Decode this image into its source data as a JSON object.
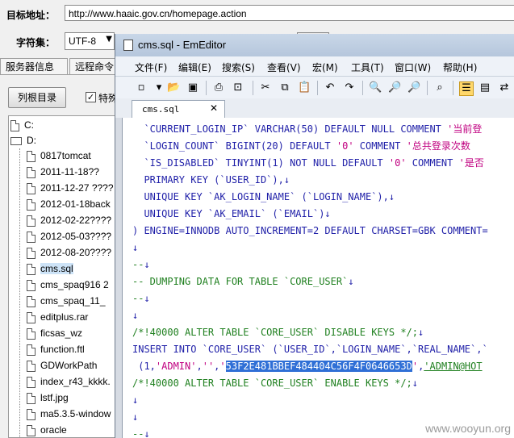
{
  "address": {
    "label": "目标地址：",
    "url": "http://www.haaic.gov.cn/homepage.action"
  },
  "charset": {
    "label": "字符集：",
    "value": "UTF-8"
  },
  "tabs": [
    {
      "label": "服务器信息"
    },
    {
      "label": "远程命令"
    }
  ],
  "root_button": "列根目录",
  "checkbox_label": "特殊",
  "tree": {
    "drives": [
      "C:",
      "D:"
    ],
    "items": [
      "0817tomcat",
      "2011-11-18??",
      "2011-12-27 ????",
      "2012-01-18back",
      "2012-02-22????",
      "2012-05-03????",
      "2012-08-20????",
      "cms.sql",
      "cms_spaq916 2",
      "cms_spaq_11_",
      "editplus.rar",
      "ficsas_wz",
      "function.ftl",
      "GDWorkPath",
      "index_r43_kkkk.",
      "lstf.jpg",
      "ma5.3.5-window",
      "oracle"
    ],
    "selected": "cms.sql"
  },
  "editor": {
    "title": "cms.sql - EmEditor",
    "menu": [
      "文件(F)",
      "编辑(E)",
      "搜索(S)",
      "查看(V)",
      "宏(M)",
      "工具(T)",
      "窗口(W)",
      "帮助(H)"
    ],
    "doc_tab": "cms.sql",
    "lines": [
      {
        "segs": [
          [
            "kw",
            "  `CURRENT_LOGIN_IP` VARCHAR(50) DEFAULT NULL COMMENT "
          ],
          [
            "str",
            "'当前登"
          ]
        ]
      },
      {
        "segs": [
          [
            "kw",
            "  `LOGIN_COUNT` BIGINT(20) DEFAULT "
          ],
          [
            "str",
            "'0'"
          ],
          [
            "kw",
            " COMMENT "
          ],
          [
            "str",
            "'总共登录次数"
          ]
        ]
      },
      {
        "segs": [
          [
            "kw",
            "  `IS_DISABLED` TINYINT(1) NOT NULL DEFAULT "
          ],
          [
            "str",
            "'0'"
          ],
          [
            "kw",
            " COMMENT "
          ],
          [
            "str",
            "'是否"
          ]
        ]
      },
      {
        "segs": [
          [
            "kw",
            "  PRIMARY KEY (`USER_ID`),"
          ],
          [
            "nl",
            "↓"
          ]
        ]
      },
      {
        "segs": [
          [
            "kw",
            "  UNIQUE KEY `AK_LOGIN_NAME` (`LOGIN_NAME`),"
          ],
          [
            "nl",
            "↓"
          ]
        ]
      },
      {
        "segs": [
          [
            "kw",
            "  UNIQUE KEY `AK_EMAIL` (`EMAIL`)"
          ],
          [
            "nl",
            "↓"
          ]
        ]
      },
      {
        "segs": [
          [
            "kw",
            ") ENGINE=INNODB AUTO_INCREMENT=2 DEFAULT CHARSET=GBK COMMENT="
          ]
        ]
      },
      {
        "segs": [
          [
            "nl",
            "↓"
          ]
        ]
      },
      {
        "segs": [
          [
            "cm",
            "--"
          ],
          [
            "nl",
            "↓"
          ]
        ]
      },
      {
        "segs": [
          [
            "cm",
            "-- DUMPING DATA FOR TABLE `CORE_USER`"
          ],
          [
            "nl",
            "↓"
          ]
        ]
      },
      {
        "segs": [
          [
            "cm",
            "--"
          ],
          [
            "nl",
            "↓"
          ]
        ]
      },
      {
        "segs": [
          [
            "nl",
            "↓"
          ]
        ]
      },
      {
        "segs": [
          [
            "cm",
            "/*!40000 ALTER TABLE `CORE_USER` DISABLE KEYS */;"
          ],
          [
            "nl",
            "↓"
          ]
        ]
      },
      {
        "segs": [
          [
            "kw",
            "INSERT INTO `CORE_USER` (`USER_ID`,`LOGIN_NAME`,`REAL_NAME`,`"
          ]
        ]
      },
      {
        "segs": [
          [
            "kw",
            " (1,"
          ],
          [
            "str",
            "'ADMIN'"
          ],
          [
            "kw",
            ","
          ],
          [
            "str",
            "''"
          ],
          [
            "kw",
            ","
          ],
          [
            "str",
            "'"
          ],
          [
            "hl",
            "53F2E481BBEF484404C56F4F0646653D"
          ],
          [
            "str",
            "'"
          ],
          [
            "kw",
            ","
          ],
          [
            "ul",
            "'ADMIN@HOT"
          ]
        ]
      },
      {
        "segs": [
          [
            "cm",
            "/*!40000 ALTER TABLE `CORE_USER` ENABLE KEYS */;"
          ],
          [
            "nl",
            "↓"
          ]
        ]
      },
      {
        "segs": [
          [
            "nl",
            "↓"
          ]
        ]
      },
      {
        "segs": [
          [
            "nl",
            "↓"
          ]
        ]
      },
      {
        "segs": [
          [
            "cm",
            "--"
          ],
          [
            "nl",
            "↓"
          ]
        ]
      }
    ]
  },
  "watermark": "www.wooyun.org"
}
